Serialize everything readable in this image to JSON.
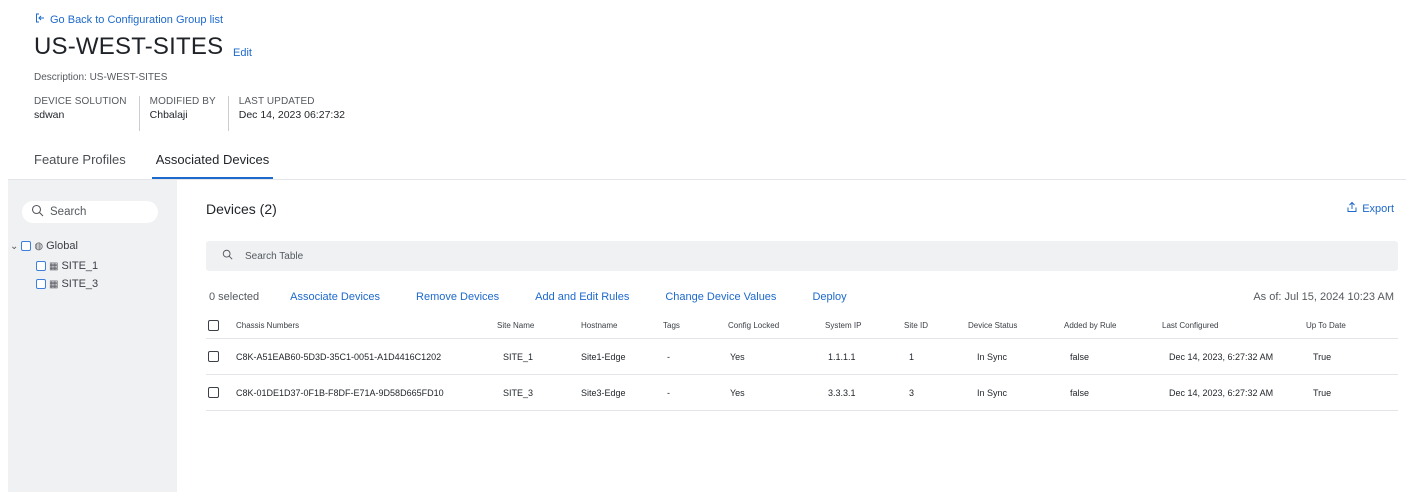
{
  "back_link": "Go Back to Configuration Group list",
  "title": "US-WEST-SITES",
  "edit_label": "Edit",
  "description": "Description: US-WEST-SITES",
  "meta": [
    {
      "label": "DEVICE SOLUTION",
      "value": "sdwan"
    },
    {
      "label": "MODIFIED BY",
      "value": "Chbalaji"
    },
    {
      "label": "LAST UPDATED",
      "value": "Dec 14, 2023 06:27:32"
    }
  ],
  "tabs": [
    {
      "label": "Feature Profiles",
      "active": false
    },
    {
      "label": "Associated Devices",
      "active": true
    }
  ],
  "sidebar": {
    "search_placeholder": "Search",
    "tree": [
      {
        "label": "Global",
        "level": 0
      },
      {
        "label": "SITE_1",
        "level": 1
      },
      {
        "label": "SITE_3",
        "level": 1
      }
    ]
  },
  "devices_title": "Devices (2)",
  "export_label": "Export",
  "table_search_placeholder": "Search Table",
  "selected_count": "0 selected",
  "actions": [
    "Associate Devices",
    "Remove Devices",
    "Add and Edit Rules",
    "Change Device Values",
    "Deploy"
  ],
  "as_of": "As of:  Jul 15, 2024 10:23 AM",
  "columns": [
    "Chassis Numbers",
    "Site Name",
    "Hostname",
    "Tags",
    "Config Locked",
    "System IP",
    "Site ID",
    "Device Status",
    "Added by Rule",
    "Last Configured",
    "Up To Date"
  ],
  "rows": [
    [
      "C8K-A51EAB60-5D3D-35C1-0051-A1D4416C1202",
      "SITE_1",
      "Site1-Edge",
      "-",
      "Yes",
      "1.1.1.1",
      "1",
      "In Sync",
      "false",
      "Dec 14, 2023, 6:27:32 AM",
      "True"
    ],
    [
      "C8K-01DE1D37-0F1B-F8DF-E71A-9D58D665FD10",
      "SITE_3",
      "Site3-Edge",
      "-",
      "Yes",
      "3.3.3.1",
      "3",
      "In Sync",
      "false",
      "Dec 14, 2023, 6:27:32 AM",
      "True"
    ]
  ],
  "colors": {
    "accent": "#1d69cc",
    "sidebar_bg": "#eff1f3",
    "text": "#1f2328"
  }
}
